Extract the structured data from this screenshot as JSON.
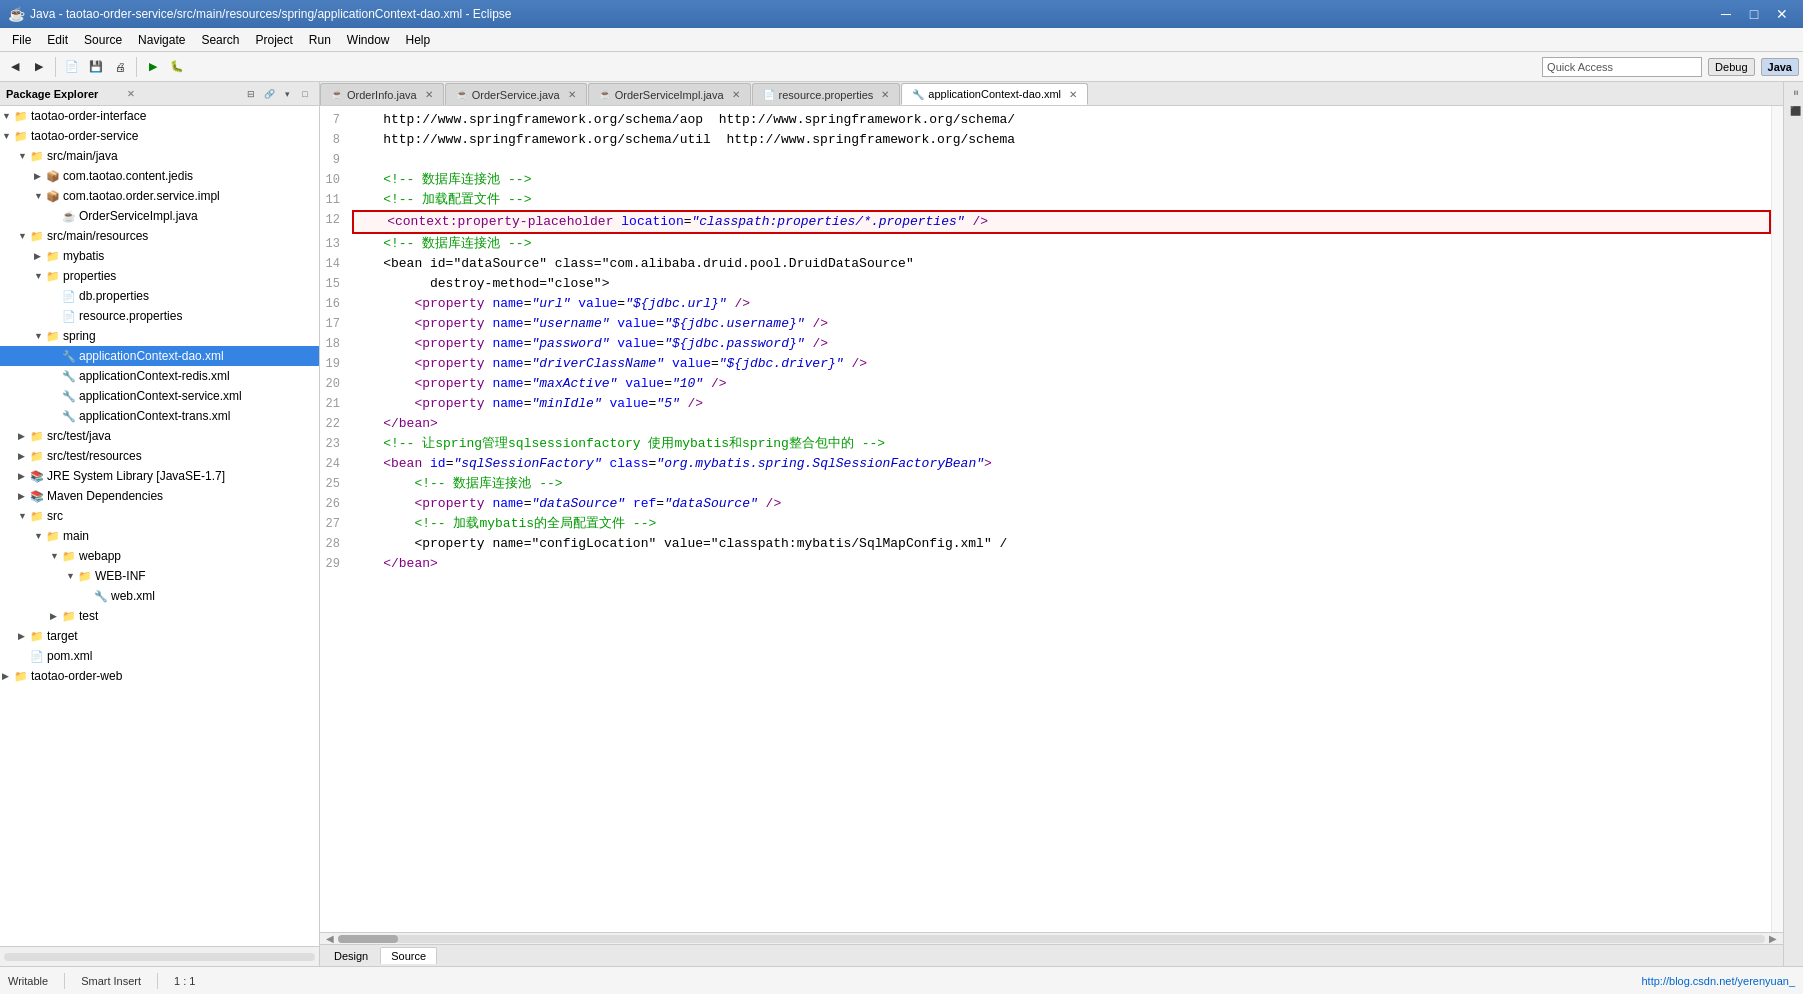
{
  "titleBar": {
    "icon": "☕",
    "title": "Java - taotao-order-service/src/main/resources/spring/applicationContext-dao.xml - Eclipse",
    "minimizeLabel": "─",
    "maximizeLabel": "□",
    "closeLabel": "✕"
  },
  "menuBar": {
    "items": [
      "File",
      "Edit",
      "Source",
      "Navigate",
      "Search",
      "Project",
      "Run",
      "Window",
      "Help"
    ]
  },
  "toolbar": {
    "quickAccess": "Quick Access",
    "perspectiveDebug": "Debug",
    "perspectiveJava": "Java"
  },
  "packageExplorer": {
    "title": "Package Explorer",
    "trees": [
      {
        "indent": 0,
        "arrow": "▼",
        "icon": "📁",
        "label": "taotao-order-interface",
        "type": "project"
      },
      {
        "indent": 0,
        "arrow": "▼",
        "icon": "📁",
        "label": "taotao-order-service",
        "type": "project"
      },
      {
        "indent": 1,
        "arrow": "▼",
        "icon": "📁",
        "label": "src/main/java",
        "type": "folder"
      },
      {
        "indent": 2,
        "arrow": "▶",
        "icon": "📦",
        "label": "com.taotao.content.jedis",
        "type": "package"
      },
      {
        "indent": 2,
        "arrow": "▼",
        "icon": "📦",
        "label": "com.taotao.order.service.impl",
        "type": "package"
      },
      {
        "indent": 3,
        "arrow": "",
        "icon": "☕",
        "label": "OrderServiceImpl.java",
        "type": "java"
      },
      {
        "indent": 1,
        "arrow": "▼",
        "icon": "📁",
        "label": "src/main/resources",
        "type": "folder"
      },
      {
        "indent": 2,
        "arrow": "▶",
        "icon": "📁",
        "label": "mybatis",
        "type": "folder"
      },
      {
        "indent": 2,
        "arrow": "▼",
        "icon": "📁",
        "label": "properties",
        "type": "folder"
      },
      {
        "indent": 3,
        "arrow": "",
        "icon": "📄",
        "label": "db.properties",
        "type": "file"
      },
      {
        "indent": 3,
        "arrow": "",
        "icon": "📄",
        "label": "resource.properties",
        "type": "file"
      },
      {
        "indent": 2,
        "arrow": "▼",
        "icon": "📁",
        "label": "spring",
        "type": "folder"
      },
      {
        "indent": 3,
        "arrow": "",
        "icon": "🔧",
        "label": "applicationContext-dao.xml",
        "type": "xml",
        "selected": true
      },
      {
        "indent": 3,
        "arrow": "",
        "icon": "🔧",
        "label": "applicationContext-redis.xml",
        "type": "xml"
      },
      {
        "indent": 3,
        "arrow": "",
        "icon": "🔧",
        "label": "applicationContext-service.xml",
        "type": "xml"
      },
      {
        "indent": 3,
        "arrow": "",
        "icon": "🔧",
        "label": "applicationContext-trans.xml",
        "type": "xml"
      },
      {
        "indent": 1,
        "arrow": "▶",
        "icon": "📁",
        "label": "src/test/java",
        "type": "folder"
      },
      {
        "indent": 1,
        "arrow": "▶",
        "icon": "📁",
        "label": "src/test/resources",
        "type": "folder"
      },
      {
        "indent": 1,
        "arrow": "▶",
        "icon": "📚",
        "label": "JRE System Library [JavaSE-1.7]",
        "type": "library"
      },
      {
        "indent": 1,
        "arrow": "▶",
        "icon": "📚",
        "label": "Maven Dependencies",
        "type": "library"
      },
      {
        "indent": 1,
        "arrow": "▼",
        "icon": "📁",
        "label": "src",
        "type": "folder"
      },
      {
        "indent": 2,
        "arrow": "▼",
        "icon": "📁",
        "label": "main",
        "type": "folder"
      },
      {
        "indent": 3,
        "arrow": "▼",
        "icon": "📁",
        "label": "webapp",
        "type": "folder"
      },
      {
        "indent": 4,
        "arrow": "▼",
        "icon": "📁",
        "label": "WEB-INF",
        "type": "folder"
      },
      {
        "indent": 5,
        "arrow": "",
        "icon": "🔧",
        "label": "web.xml",
        "type": "xml"
      },
      {
        "indent": 3,
        "arrow": "▶",
        "icon": "📁",
        "label": "test",
        "type": "folder"
      },
      {
        "indent": 1,
        "arrow": "▶",
        "icon": "📁",
        "label": "target",
        "type": "folder"
      },
      {
        "indent": 1,
        "arrow": "",
        "icon": "📄",
        "label": "pom.xml",
        "type": "file"
      },
      {
        "indent": 0,
        "arrow": "▶",
        "icon": "📁",
        "label": "taotao-order-web",
        "type": "project"
      }
    ]
  },
  "editorTabs": [
    {
      "label": "OrderInfo.java",
      "icon": "☕",
      "active": false,
      "dirty": false
    },
    {
      "label": "OrderService.java",
      "icon": "☕",
      "active": false,
      "dirty": false
    },
    {
      "label": "OrderServiceImpl.java",
      "icon": "☕",
      "active": false,
      "dirty": false
    },
    {
      "label": "resource.properties",
      "icon": "📄",
      "active": false,
      "dirty": false
    },
    {
      "label": "applicationContext-dao.xml",
      "icon": "🔧",
      "active": true,
      "dirty": false
    }
  ],
  "codeLines": [
    {
      "num": 7,
      "content": "    http://www.springframework.org/schema/aop  http://www.springframework.org/schema/",
      "highlight": false
    },
    {
      "num": 8,
      "content": "    http://www.springframework.org/schema/util  http://www.springframework.org/schema",
      "highlight": false
    },
    {
      "num": 9,
      "content": "",
      "highlight": false
    },
    {
      "num": 10,
      "content": "    <!-- 数据库连接池 -->",
      "highlight": false
    },
    {
      "num": 11,
      "content": "    <!-- 加载配置文件 -->",
      "highlight": false
    },
    {
      "num": 12,
      "content": "    <context:property-placeholder location=\"classpath:properties/*.properties\" />",
      "highlight": true
    },
    {
      "num": 13,
      "content": "    <!-- 数据库连接池 -->",
      "highlight": false
    },
    {
      "num": 14,
      "content": "    <bean id=\"dataSource\" class=\"com.alibaba.druid.pool.DruidDataSource\"",
      "highlight": false
    },
    {
      "num": 15,
      "content": "          destroy-method=\"close\">",
      "highlight": false
    },
    {
      "num": 16,
      "content": "        <property name=\"url\" value=\"${jdbc.url}\" />",
      "highlight": false
    },
    {
      "num": 17,
      "content": "        <property name=\"username\" value=\"${jdbc.username}\" />",
      "highlight": false
    },
    {
      "num": 18,
      "content": "        <property name=\"password\" value=\"${jdbc.password}\" />",
      "highlight": false
    },
    {
      "num": 19,
      "content": "        <property name=\"driverClassName\" value=\"${jdbc.driver}\" />",
      "highlight": false
    },
    {
      "num": 20,
      "content": "        <property name=\"maxActive\" value=\"10\" />",
      "highlight": false
    },
    {
      "num": 21,
      "content": "        <property name=\"minIdle\" value=\"5\" />",
      "highlight": false
    },
    {
      "num": 22,
      "content": "    </bean>",
      "highlight": false
    },
    {
      "num": 23,
      "content": "    <!-- 让spring管理sqlsessionfactory 使用mybatis和spring整合包中的 -->",
      "highlight": false
    },
    {
      "num": 24,
      "content": "    <bean id=\"sqlSessionFactory\" class=\"org.mybatis.spring.SqlSessionFactoryBean\">",
      "highlight": false
    },
    {
      "num": 25,
      "content": "        <!-- 数据库连接池 -->",
      "highlight": false
    },
    {
      "num": 26,
      "content": "        <property name=\"dataSource\" ref=\"dataSource\" />",
      "highlight": false
    },
    {
      "num": 27,
      "content": "        <!-- 加载mybatis的全局配置文件 -->",
      "highlight": false
    },
    {
      "num": 28,
      "content": "        <property name=\"configLocation\" value=\"classpath:mybatis/SqlMapConfig.xml\" /",
      "highlight": false
    },
    {
      "num": 29,
      "content": "    </bean>",
      "highlight": false
    }
  ],
  "bottomTabs": [
    {
      "label": "Design",
      "active": false
    },
    {
      "label": "Source",
      "active": true
    }
  ],
  "statusBar": {
    "writable": "Writable",
    "insertMode": "Smart Insert",
    "position": "1 : 1",
    "link": "http://blog.csdn.net/yerenyuan_"
  }
}
